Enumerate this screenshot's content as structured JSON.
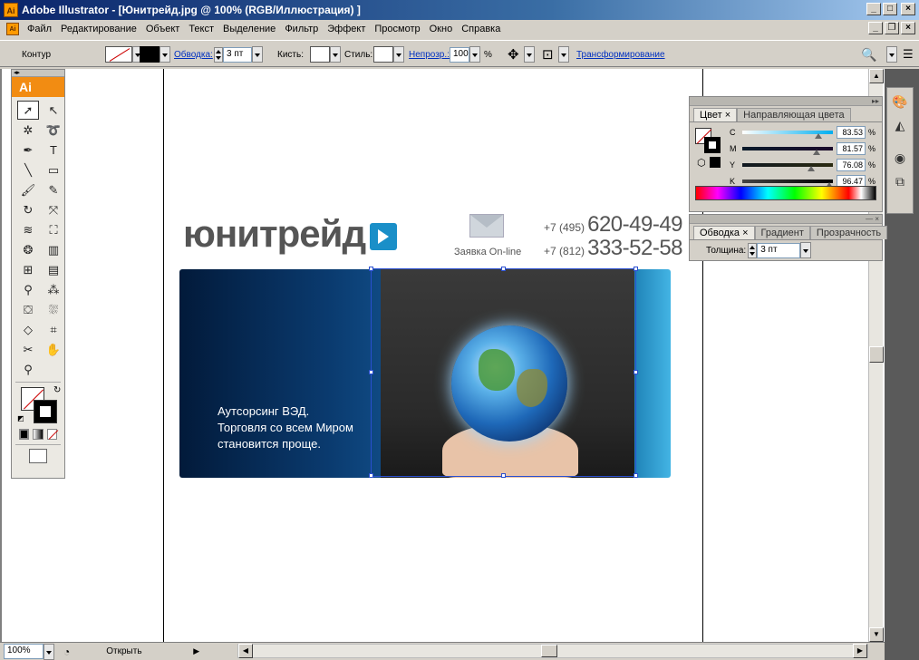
{
  "window": {
    "title": "Adobe Illustrator - [Юнитрейд.jpg @ 100% (RGB/Иллюстрация) ]",
    "app_icon": "Ai",
    "btn_minimize": "_",
    "btn_maximize": "□",
    "btn_close": "×",
    "btn_restore": "❐"
  },
  "menu": {
    "doc_icon": "Ai",
    "items": [
      "Файл",
      "Редактирование",
      "Объект",
      "Текст",
      "Выделение",
      "Фильтр",
      "Эффект",
      "Просмотр",
      "Окно",
      "Справка"
    ]
  },
  "control_bar": {
    "label": "Контур",
    "stroke_link": "Обводка:",
    "stroke_weight": "3 пт",
    "brush_label": "Кисть:",
    "style_label": "Стиль:",
    "opacity_link": "Непрозр.:",
    "opacity_value": "100",
    "percent": "%",
    "transform_link": "Трансформирование"
  },
  "toolbox": {
    "header": "Ai",
    "grip": "◂▸",
    "tools": [
      {
        "name": "selection-tool",
        "glyph": "➚"
      },
      {
        "name": "direct-selection-tool",
        "glyph": "↖"
      },
      {
        "name": "magic-wand-tool",
        "glyph": "✲"
      },
      {
        "name": "lasso-tool",
        "glyph": "➰"
      },
      {
        "name": "pen-tool",
        "glyph": "✒"
      },
      {
        "name": "type-tool",
        "glyph": "T"
      },
      {
        "name": "line-tool",
        "glyph": "╲"
      },
      {
        "name": "rectangle-tool",
        "glyph": "▭"
      },
      {
        "name": "paintbrush-tool",
        "glyph": "🖌"
      },
      {
        "name": "pencil-tool",
        "glyph": "✎"
      },
      {
        "name": "rotate-tool",
        "glyph": "↻"
      },
      {
        "name": "free-transform-tool",
        "glyph": "⤧"
      },
      {
        "name": "warp-tool",
        "glyph": "≋"
      },
      {
        "name": "free-distort-tool",
        "glyph": "⛶"
      },
      {
        "name": "symbol-sprayer-tool",
        "glyph": "❂"
      },
      {
        "name": "graph-tool",
        "glyph": "▥"
      },
      {
        "name": "mesh-tool",
        "glyph": "⊞"
      },
      {
        "name": "gradient-tool",
        "glyph": "▤"
      },
      {
        "name": "eyedropper-tool",
        "glyph": "⚲"
      },
      {
        "name": "blend-tool",
        "glyph": "⁂"
      },
      {
        "name": "live-paint-tool",
        "glyph": "⛋"
      },
      {
        "name": "live-paint-selection-tool",
        "glyph": "⛆"
      },
      {
        "name": "eraser-tool",
        "glyph": "◇"
      },
      {
        "name": "slice-tool",
        "glyph": "⌗"
      },
      {
        "name": "scissors-tool",
        "glyph": "✂"
      },
      {
        "name": "hand-tool",
        "glyph": "✋"
      },
      {
        "name": "zoom-tool",
        "glyph": "⚲"
      }
    ]
  },
  "artwork": {
    "logo": "юнитрейд",
    "mail_label": "Заявка On-line",
    "phone1_code": "+7 (495)",
    "phone1_number": "620-49-49",
    "phone2_code": "+7 (812)",
    "phone2_number": "333-52-58",
    "slogan": [
      "Аутсорсинг ВЭД.",
      "Торговля со всем Миром",
      "становится проще."
    ]
  },
  "color_panel": {
    "tab_active": "Цвет",
    "tab_inactive": "Направляющая цвета",
    "channels": [
      {
        "label": "C",
        "value": "83.53",
        "fill": 0.8353,
        "gradient": "linear-gradient(to right,#fff,#00aeef)"
      },
      {
        "label": "M",
        "value": "81.57",
        "fill": 0.8157,
        "gradient": "linear-gradient(to right,#0a1a2a,#1a0a2a)"
      },
      {
        "label": "Y",
        "value": "76.08",
        "fill": 0.7608,
        "gradient": "linear-gradient(to right,#101820,#2a2a10)"
      },
      {
        "label": "K",
        "value": "96.47",
        "fill": 0.9647,
        "gradient": "linear-gradient(to right,#444,#000)"
      }
    ],
    "percent": "%"
  },
  "stroke_panel": {
    "tab_active": "Обводка",
    "tab_inactive1": "Градиент",
    "tab_inactive2": "Прозрачность",
    "weight_label": "Толщина:",
    "weight_value": "3 пт"
  },
  "status_bar": {
    "zoom": "100%",
    "info": "Открыть"
  }
}
